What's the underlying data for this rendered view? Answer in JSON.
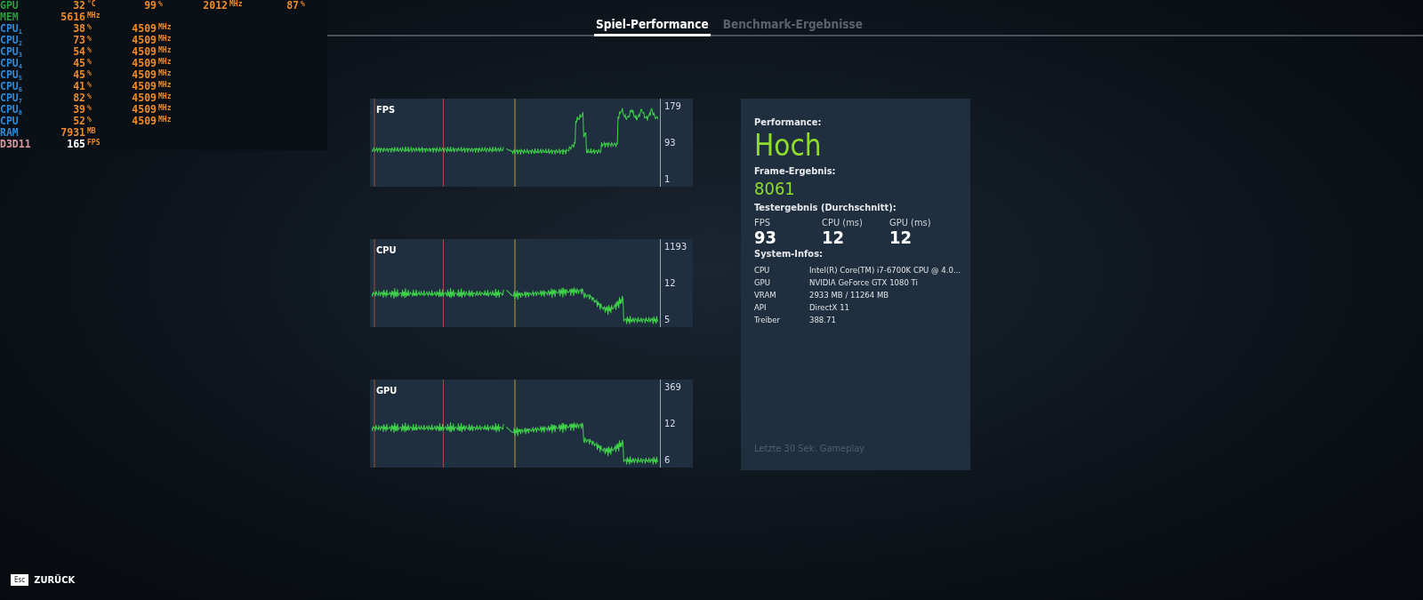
{
  "overlay": [
    {
      "kind": "gpu",
      "label": "GPU",
      "values": [
        {
          "value": "32",
          "unit": "°C"
        },
        {
          "value": "99",
          "unit": "%"
        },
        {
          "value": "2012",
          "unit": "MHz"
        },
        {
          "value": "87",
          "unit": "%"
        }
      ]
    },
    {
      "kind": "mem",
      "label": "MEM",
      "values": [
        {
          "value": "5616",
          "unit": "MHz"
        }
      ]
    },
    {
      "kind": "cpu",
      "label": "CPU$_{1}$",
      "values": [
        {
          "value": "38",
          "unit": "%"
        },
        {
          "value": "4509",
          "unit": "MHz"
        }
      ]
    },
    {
      "kind": "cpu",
      "label": "CPU$_{2}$",
      "values": [
        {
          "value": "73",
          "unit": "%"
        },
        {
          "value": "4509",
          "unit": "MHz"
        }
      ]
    },
    {
      "kind": "cpu",
      "label": "CPU$_{3}$",
      "values": [
        {
          "value": "54",
          "unit": "%"
        },
        {
          "value": "4509",
          "unit": "MHz"
        }
      ]
    },
    {
      "kind": "cpu",
      "label": "CPU$_{4}$",
      "values": [
        {
          "value": "45",
          "unit": "%"
        },
        {
          "value": "4509",
          "unit": "MHz"
        }
      ]
    },
    {
      "kind": "cpu",
      "label": "CPU$_{5}$",
      "values": [
        {
          "value": "45",
          "unit": "%"
        },
        {
          "value": "4509",
          "unit": "MHz"
        }
      ]
    },
    {
      "kind": "cpu",
      "label": "CPU$_{6}$",
      "values": [
        {
          "value": "41",
          "unit": "%"
        },
        {
          "value": "4509",
          "unit": "MHz"
        }
      ]
    },
    {
      "kind": "cpu",
      "label": "CPU$_{7}$",
      "values": [
        {
          "value": "82",
          "unit": "%"
        },
        {
          "value": "4509",
          "unit": "MHz"
        }
      ]
    },
    {
      "kind": "cpu",
      "label": "CPU$_{8}$",
      "values": [
        {
          "value": "39",
          "unit": "%"
        },
        {
          "value": "4509",
          "unit": "MHz"
        }
      ]
    },
    {
      "kind": "cpu",
      "label": "CPU",
      "values": [
        {
          "value": "52",
          "unit": "%"
        },
        {
          "value": "4509",
          "unit": "MHz"
        }
      ]
    },
    {
      "kind": "ram",
      "label": "RAM",
      "values": [
        {
          "value": "7931",
          "unit": "MB"
        }
      ]
    },
    {
      "kind": "api",
      "label": "D3D11",
      "values": [
        {
          "value": "165",
          "unit": "FPS"
        }
      ]
    }
  ],
  "tabs": [
    {
      "label": "Spiel-Performance",
      "selected": true
    },
    {
      "label": "Benchmark-Ergebnisse",
      "selected": false
    }
  ],
  "graphs": [
    {
      "title": "FPS",
      "ticks": [
        "179",
        "93",
        "1"
      ]
    },
    {
      "title": "CPU",
      "ticks": [
        "1193",
        "12",
        "5"
      ]
    },
    {
      "title": "GPU",
      "ticks": [
        "369",
        "12",
        "6"
      ]
    }
  ],
  "results": {
    "performance_label": "Performance:",
    "performance_value": "Hoch",
    "frame_label": "Frame-Ergebnis:",
    "frame_value": "8061",
    "average_label": "Testergebnis (Durchschnitt):",
    "averages": [
      {
        "label": "FPS",
        "value": "93"
      },
      {
        "label": "CPU (ms)",
        "value": "12"
      },
      {
        "label": "GPU (ms)",
        "value": "12"
      }
    ],
    "system_label": "System-Infos:",
    "system": [
      {
        "key": "CPU",
        "value": "Intel(R) Core(TM) i7-6700K CPU @ 4.0..."
      },
      {
        "key": "GPU",
        "value": "NVIDIA GeForce GTX 1080 Ti"
      },
      {
        "key": "VRAM",
        "value": "2933 MB / 11264 MB"
      },
      {
        "key": "API",
        "value": "DirectX 11"
      },
      {
        "key": "Treiber",
        "value": "388.71"
      }
    ],
    "footnote": "Letzte 30 Sek. Gameplay"
  },
  "back": {
    "key": "Esc",
    "label": "ZURÜCK"
  }
}
